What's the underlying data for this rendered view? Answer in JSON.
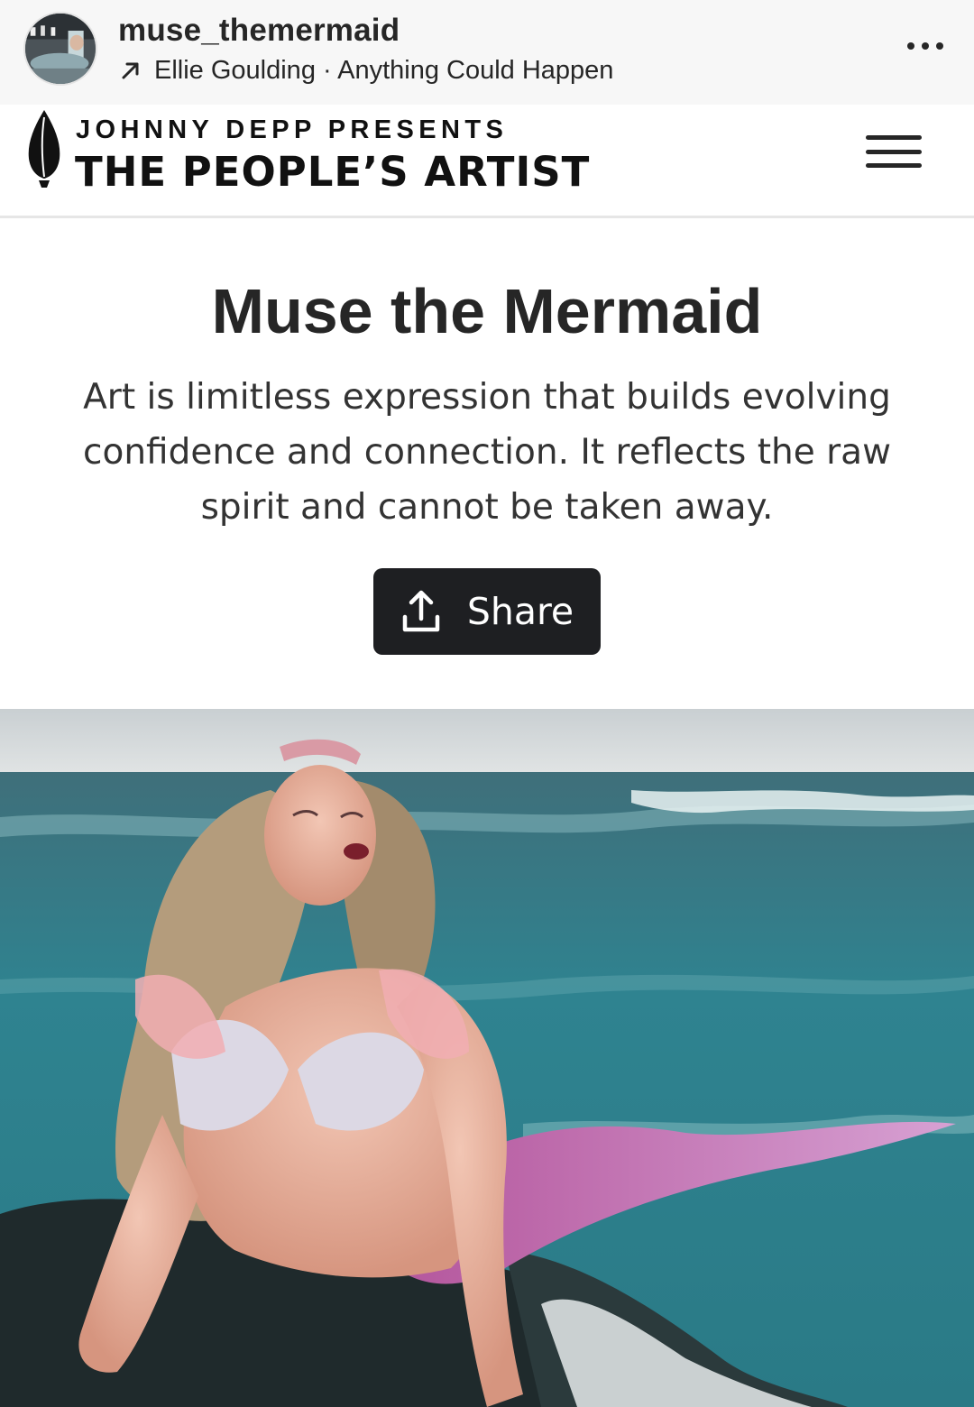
{
  "post_header": {
    "username": "muse_themermaid",
    "music_label": "Ellie Goulding · Anything Could Happen",
    "avatar_icon": "profile-avatar",
    "arrow_icon": "north-east-arrow-icon",
    "more_icon": "more-dots-icon"
  },
  "site_nav": {
    "logo_icon": "quill-pen-icon",
    "presents": "JOHNNY DEPP PRESENTS",
    "brand": "THE PEOPLE’S ARTIST",
    "menu_icon": "hamburger-menu-icon"
  },
  "hero": {
    "title": "Muse the Mermaid",
    "description": "Art is limitless expression that builds evolving confidence and connection. It reflects the raw spirit and cannot be taken away.",
    "share_label": "Share",
    "share_icon": "upload-icon"
  },
  "colors": {
    "header_bg": "#f7f7f7",
    "text": "#262626",
    "button_bg": "#1e1f22",
    "button_text": "#ffffff",
    "sea": "#2f7f8a",
    "tail": "#c98bc4"
  }
}
